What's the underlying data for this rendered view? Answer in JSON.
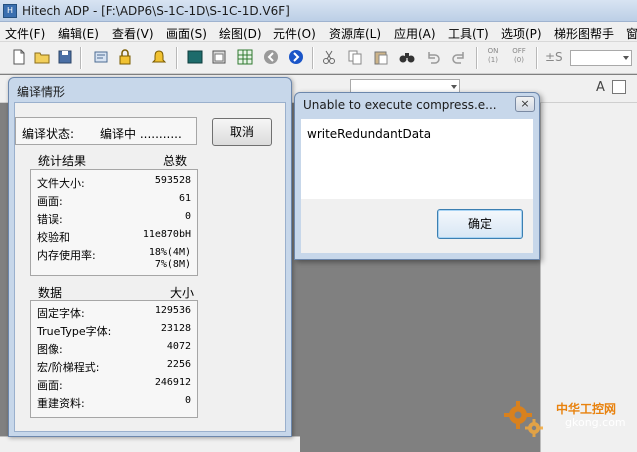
{
  "app": {
    "title": "Hitech ADP - [F:\\ADP6\\S-1C-1D\\S-1C-1D.V6F]"
  },
  "menu": [
    {
      "label": "文件(F)"
    },
    {
      "label": "编辑(E)"
    },
    {
      "label": "查看(V)"
    },
    {
      "label": "画面(S)"
    },
    {
      "label": "绘图(D)"
    },
    {
      "label": "元件(O)"
    },
    {
      "label": "资源库(L)"
    },
    {
      "label": "应用(A)"
    },
    {
      "label": "工具(T)"
    },
    {
      "label": "选项(P)"
    },
    {
      "label": "梯形图帮手"
    },
    {
      "label": "窗"
    }
  ],
  "toolbar": {
    "on_label": "ON\n(1)",
    "off_label": "OFF\n(0)",
    "s_label": "±S"
  },
  "compile_dialog": {
    "title": "编译情形",
    "status_label": "编译状态:",
    "status_value": "编译中 ...........",
    "cancel_label": "取消",
    "stats_header": "统计结果",
    "stats_total_header": "总数",
    "stats": [
      {
        "key": "文件大小:",
        "value": "593528"
      },
      {
        "key": "画面:",
        "value": "61"
      },
      {
        "key": "错误:",
        "value": "0"
      },
      {
        "key": "校验和",
        "value": "11e870bH"
      },
      {
        "key": "内存使用率:",
        "value": "18%(4M)"
      },
      {
        "key": "",
        "value": "7%(8M)"
      }
    ],
    "data_header": "数据",
    "data_size_header": "大小",
    "data": [
      {
        "key": "固定字体:",
        "value": "129536"
      },
      {
        "key": "TrueType字体:",
        "value": "23128"
      },
      {
        "key": "图像:",
        "value": "4072"
      },
      {
        "key": "宏/阶梯程式:",
        "value": "2256"
      },
      {
        "key": "画面:",
        "value": "246912"
      },
      {
        "key": "重建资料:",
        "value": "0"
      }
    ]
  },
  "error_dialog": {
    "title": "Unable to execute compress.e...",
    "close_label": "×",
    "message": "writeRedundantData",
    "ok_label": "确定"
  },
  "watermark": {
    "cn": "中华工控网",
    "url": "gkong.com"
  },
  "colors": {
    "title_bar": "#bccfe6",
    "workspace": "#808080",
    "accent_orange": "#e8820e"
  }
}
